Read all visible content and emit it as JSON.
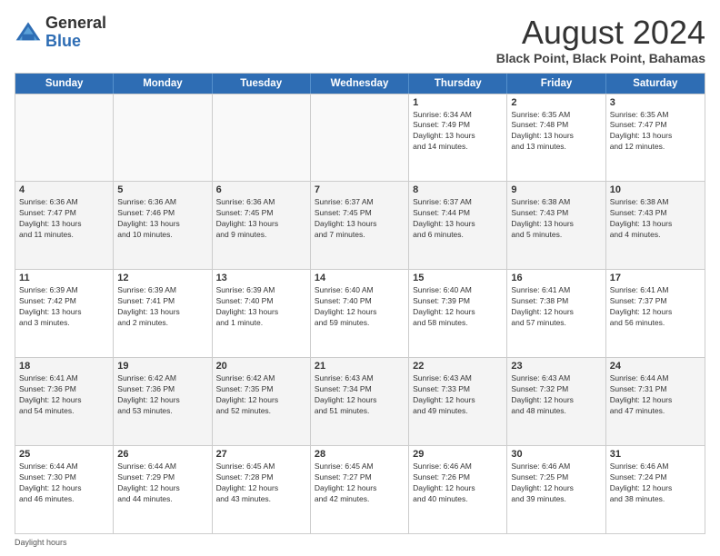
{
  "header": {
    "logo_general": "General",
    "logo_blue": "Blue",
    "month_title": "August 2024",
    "subtitle": "Black Point, Black Point, Bahamas"
  },
  "days_of_week": [
    "Sunday",
    "Monday",
    "Tuesday",
    "Wednesday",
    "Thursday",
    "Friday",
    "Saturday"
  ],
  "weeks": [
    [
      {
        "day": "",
        "info": "",
        "empty": true
      },
      {
        "day": "",
        "info": "",
        "empty": true
      },
      {
        "day": "",
        "info": "",
        "empty": true
      },
      {
        "day": "",
        "info": "",
        "empty": true
      },
      {
        "day": "1",
        "info": "Sunrise: 6:34 AM\nSunset: 7:49 PM\nDaylight: 13 hours\nand 14 minutes.",
        "empty": false
      },
      {
        "day": "2",
        "info": "Sunrise: 6:35 AM\nSunset: 7:48 PM\nDaylight: 13 hours\nand 13 minutes.",
        "empty": false
      },
      {
        "day": "3",
        "info": "Sunrise: 6:35 AM\nSunset: 7:47 PM\nDaylight: 13 hours\nand 12 minutes.",
        "empty": false
      }
    ],
    [
      {
        "day": "4",
        "info": "Sunrise: 6:36 AM\nSunset: 7:47 PM\nDaylight: 13 hours\nand 11 minutes.",
        "empty": false
      },
      {
        "day": "5",
        "info": "Sunrise: 6:36 AM\nSunset: 7:46 PM\nDaylight: 13 hours\nand 10 minutes.",
        "empty": false
      },
      {
        "day": "6",
        "info": "Sunrise: 6:36 AM\nSunset: 7:45 PM\nDaylight: 13 hours\nand 9 minutes.",
        "empty": false
      },
      {
        "day": "7",
        "info": "Sunrise: 6:37 AM\nSunset: 7:45 PM\nDaylight: 13 hours\nand 7 minutes.",
        "empty": false
      },
      {
        "day": "8",
        "info": "Sunrise: 6:37 AM\nSunset: 7:44 PM\nDaylight: 13 hours\nand 6 minutes.",
        "empty": false
      },
      {
        "day": "9",
        "info": "Sunrise: 6:38 AM\nSunset: 7:43 PM\nDaylight: 13 hours\nand 5 minutes.",
        "empty": false
      },
      {
        "day": "10",
        "info": "Sunrise: 6:38 AM\nSunset: 7:43 PM\nDaylight: 13 hours\nand 4 minutes.",
        "empty": false
      }
    ],
    [
      {
        "day": "11",
        "info": "Sunrise: 6:39 AM\nSunset: 7:42 PM\nDaylight: 13 hours\nand 3 minutes.",
        "empty": false
      },
      {
        "day": "12",
        "info": "Sunrise: 6:39 AM\nSunset: 7:41 PM\nDaylight: 13 hours\nand 2 minutes.",
        "empty": false
      },
      {
        "day": "13",
        "info": "Sunrise: 6:39 AM\nSunset: 7:40 PM\nDaylight: 13 hours\nand 1 minute.",
        "empty": false
      },
      {
        "day": "14",
        "info": "Sunrise: 6:40 AM\nSunset: 7:40 PM\nDaylight: 12 hours\nand 59 minutes.",
        "empty": false
      },
      {
        "day": "15",
        "info": "Sunrise: 6:40 AM\nSunset: 7:39 PM\nDaylight: 12 hours\nand 58 minutes.",
        "empty": false
      },
      {
        "day": "16",
        "info": "Sunrise: 6:41 AM\nSunset: 7:38 PM\nDaylight: 12 hours\nand 57 minutes.",
        "empty": false
      },
      {
        "day": "17",
        "info": "Sunrise: 6:41 AM\nSunset: 7:37 PM\nDaylight: 12 hours\nand 56 minutes.",
        "empty": false
      }
    ],
    [
      {
        "day": "18",
        "info": "Sunrise: 6:41 AM\nSunset: 7:36 PM\nDaylight: 12 hours\nand 54 minutes.",
        "empty": false
      },
      {
        "day": "19",
        "info": "Sunrise: 6:42 AM\nSunset: 7:36 PM\nDaylight: 12 hours\nand 53 minutes.",
        "empty": false
      },
      {
        "day": "20",
        "info": "Sunrise: 6:42 AM\nSunset: 7:35 PM\nDaylight: 12 hours\nand 52 minutes.",
        "empty": false
      },
      {
        "day": "21",
        "info": "Sunrise: 6:43 AM\nSunset: 7:34 PM\nDaylight: 12 hours\nand 51 minutes.",
        "empty": false
      },
      {
        "day": "22",
        "info": "Sunrise: 6:43 AM\nSunset: 7:33 PM\nDaylight: 12 hours\nand 49 minutes.",
        "empty": false
      },
      {
        "day": "23",
        "info": "Sunrise: 6:43 AM\nSunset: 7:32 PM\nDaylight: 12 hours\nand 48 minutes.",
        "empty": false
      },
      {
        "day": "24",
        "info": "Sunrise: 6:44 AM\nSunset: 7:31 PM\nDaylight: 12 hours\nand 47 minutes.",
        "empty": false
      }
    ],
    [
      {
        "day": "25",
        "info": "Sunrise: 6:44 AM\nSunset: 7:30 PM\nDaylight: 12 hours\nand 46 minutes.",
        "empty": false
      },
      {
        "day": "26",
        "info": "Sunrise: 6:44 AM\nSunset: 7:29 PM\nDaylight: 12 hours\nand 44 minutes.",
        "empty": false
      },
      {
        "day": "27",
        "info": "Sunrise: 6:45 AM\nSunset: 7:28 PM\nDaylight: 12 hours\nand 43 minutes.",
        "empty": false
      },
      {
        "day": "28",
        "info": "Sunrise: 6:45 AM\nSunset: 7:27 PM\nDaylight: 12 hours\nand 42 minutes.",
        "empty": false
      },
      {
        "day": "29",
        "info": "Sunrise: 6:46 AM\nSunset: 7:26 PM\nDaylight: 12 hours\nand 40 minutes.",
        "empty": false
      },
      {
        "day": "30",
        "info": "Sunrise: 6:46 AM\nSunset: 7:25 PM\nDaylight: 12 hours\nand 39 minutes.",
        "empty": false
      },
      {
        "day": "31",
        "info": "Sunrise: 6:46 AM\nSunset: 7:24 PM\nDaylight: 12 hours\nand 38 minutes.",
        "empty": false
      }
    ]
  ],
  "footer": {
    "daylight_label": "Daylight hours"
  }
}
